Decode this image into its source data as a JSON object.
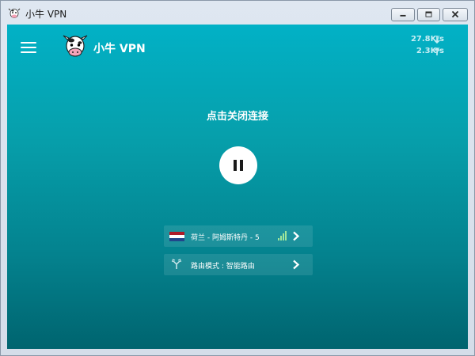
{
  "window": {
    "title": "小牛 VPN"
  },
  "header": {
    "app_name": "小牛 VPN",
    "download_speed": "27.8K/s",
    "upload_speed": "2.3K/s"
  },
  "main": {
    "status_text": "点击关闭连接",
    "server_label": "荷兰 - 阿姆斯特丹 - 5",
    "routing_label": "路由模式 : 智能路由"
  },
  "colors": {
    "accent": "#02b1c6",
    "gradient_bottom": "#00646f",
    "signal": "#9ee69a"
  }
}
